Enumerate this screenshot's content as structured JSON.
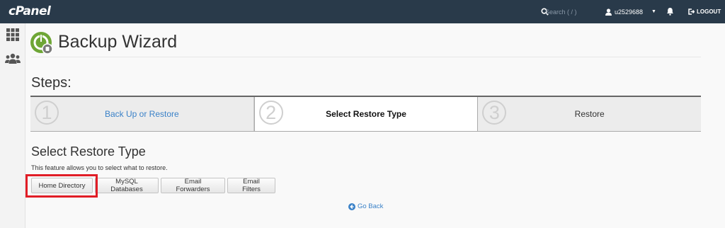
{
  "header": {
    "logo": "cPanel",
    "search_placeholder": "Search ( / )",
    "username": "u2529688",
    "logout_label": "LOGOUT"
  },
  "page": {
    "title": "Backup Wizard",
    "steps_heading": "Steps:"
  },
  "steps": [
    {
      "number": "1",
      "label": "Back Up or Restore"
    },
    {
      "number": "2",
      "label": "Select Restore Type"
    },
    {
      "number": "3",
      "label": "Restore"
    }
  ],
  "section": {
    "title": "Select Restore Type",
    "description": "This feature allows you to select what to restore.",
    "buttons": [
      "Home Directory",
      "MySQL Databases",
      "Email Forwarders",
      "Email Filters"
    ]
  },
  "go_back_label": "Go Back",
  "colors": {
    "topbar": "#293a4a",
    "link": "#3b82c8",
    "highlight": "#e11d26",
    "brand_green": "#6ea636"
  }
}
